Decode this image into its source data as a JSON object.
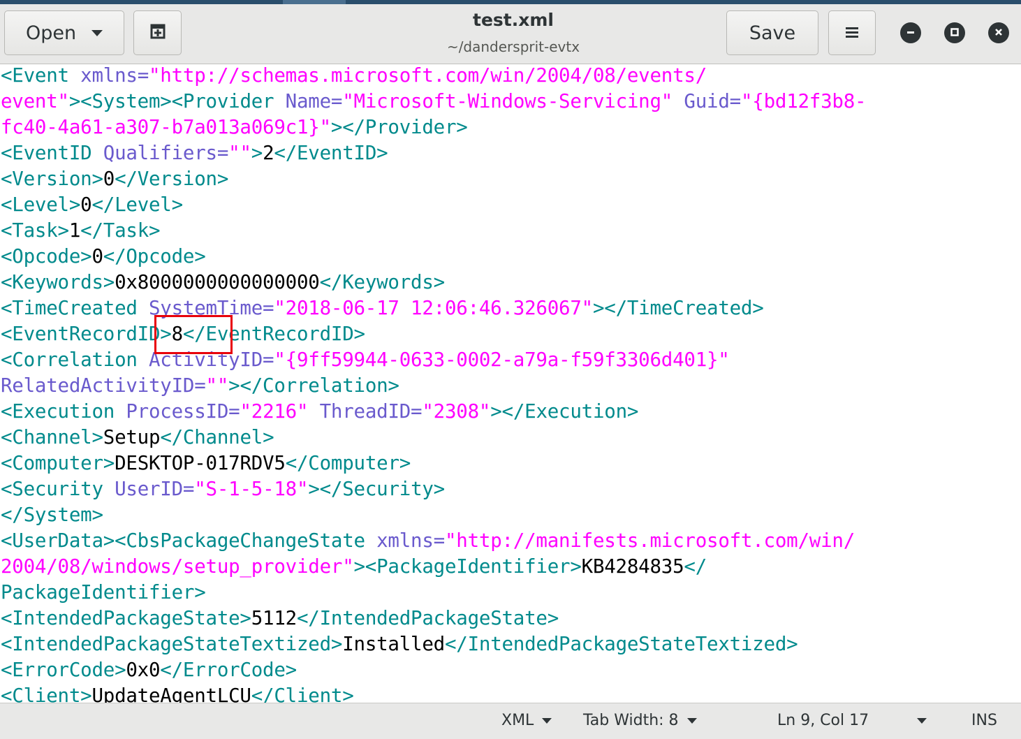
{
  "window": {
    "title": "test.xml",
    "subtitle": "~/dandersprit‑evtx"
  },
  "toolbar": {
    "open_label": "Open",
    "save_label": "Save"
  },
  "editor": {
    "lines": [
      [
        [
          "t",
          "<Event "
        ],
        [
          "a",
          "xmlns="
        ],
        [
          "v",
          "\"http://schemas.microsoft.com/win/2004/08/events/"
        ]
      ],
      [
        [
          "v",
          "event\""
        ],
        [
          "t",
          "><System><Provider "
        ],
        [
          "a",
          "Name="
        ],
        [
          "v",
          "\"Microsoft-Windows-Servicing\" "
        ],
        [
          "a",
          "Guid="
        ],
        [
          "v",
          "\"{bd12f3b8-"
        ]
      ],
      [
        [
          "v",
          "fc40-4a61-a307-b7a013a069c1}\""
        ],
        [
          "t",
          "></Provider>"
        ]
      ],
      [
        [
          "t",
          "<EventID "
        ],
        [
          "a",
          "Qualifiers="
        ],
        [
          "v",
          "\"\""
        ],
        [
          "t",
          ">"
        ],
        [
          "x",
          "2"
        ],
        [
          "t",
          "</EventID>"
        ]
      ],
      [
        [
          "t",
          "<Version>"
        ],
        [
          "x",
          "0"
        ],
        [
          "t",
          "</Version>"
        ]
      ],
      [
        [
          "t",
          "<Level>"
        ],
        [
          "x",
          "0"
        ],
        [
          "t",
          "</Level>"
        ]
      ],
      [
        [
          "t",
          "<Task>"
        ],
        [
          "x",
          "1"
        ],
        [
          "t",
          "</Task>"
        ]
      ],
      [
        [
          "t",
          "<Opcode>"
        ],
        [
          "x",
          "0"
        ],
        [
          "t",
          "</Opcode>"
        ]
      ],
      [
        [
          "t",
          "<Keywords>"
        ],
        [
          "x",
          "0x8000000000000000"
        ],
        [
          "t",
          "</Keywords>"
        ]
      ],
      [
        [
          "t",
          "<TimeCreated "
        ],
        [
          "a",
          "SystemTime="
        ],
        [
          "v",
          "\"2018-06-17 12:06:46.326067\""
        ],
        [
          "t",
          "></TimeCreated>"
        ]
      ],
      [
        [
          "t",
          "<EventRecordID>"
        ],
        [
          "x",
          "8"
        ],
        [
          "t",
          "</EventRecordID>"
        ]
      ],
      [
        [
          "t",
          "<Correlation "
        ],
        [
          "a",
          "ActivityID="
        ],
        [
          "v",
          "\"{9ff59944-0633-0002-a79a-f59f3306d401}\""
        ]
      ],
      [
        [
          "a",
          "RelatedActivityID="
        ],
        [
          "v",
          "\"\""
        ],
        [
          "t",
          "></Correlation>"
        ]
      ],
      [
        [
          "t",
          "<Execution "
        ],
        [
          "a",
          "ProcessID="
        ],
        [
          "v",
          "\"2216\" "
        ],
        [
          "a",
          "ThreadID="
        ],
        [
          "v",
          "\"2308\""
        ],
        [
          "t",
          "></Execution>"
        ]
      ],
      [
        [
          "t",
          "<Channel>"
        ],
        [
          "x",
          "Setup"
        ],
        [
          "t",
          "</Channel>"
        ]
      ],
      [
        [
          "t",
          "<Computer>"
        ],
        [
          "x",
          "DESKTOP-017RDV5"
        ],
        [
          "t",
          "</Computer>"
        ]
      ],
      [
        [
          "t",
          "<Security "
        ],
        [
          "a",
          "UserID="
        ],
        [
          "v",
          "\"S-1-5-18\""
        ],
        [
          "t",
          "></Security>"
        ]
      ],
      [
        [
          "t",
          "</System>"
        ]
      ],
      [
        [
          "t",
          "<UserData><CbsPackageChangeState "
        ],
        [
          "a",
          "xmlns="
        ],
        [
          "v",
          "\"http://manifests.microsoft.com/win/"
        ]
      ],
      [
        [
          "v",
          "2004/08/windows/setup_provider\""
        ],
        [
          "t",
          "><PackageIdentifier>"
        ],
        [
          "x",
          "KB4284835"
        ],
        [
          "t",
          "</"
        ]
      ],
      [
        [
          "t",
          "PackageIdentifier>"
        ]
      ],
      [
        [
          "t",
          "<IntendedPackageState>"
        ],
        [
          "x",
          "5112"
        ],
        [
          "t",
          "</IntendedPackageState>"
        ]
      ],
      [
        [
          "t",
          "<IntendedPackageStateTextized>"
        ],
        [
          "x",
          "Installed"
        ],
        [
          "t",
          "</IntendedPackageStateTextized>"
        ]
      ],
      [
        [
          "t",
          "<ErrorCode>"
        ],
        [
          "x",
          "0x0"
        ],
        [
          "t",
          "</ErrorCode>"
        ]
      ],
      [
        [
          "t",
          "<Client>"
        ],
        [
          "x",
          "UpdateAgentLCU"
        ],
        [
          "t",
          "</Client>"
        ]
      ]
    ]
  },
  "statusbar": {
    "language": "XML",
    "tab_width": "Tab Width: 8",
    "position": "Ln 9, Col 17",
    "mode": "INS"
  },
  "colors": {
    "tag": "#008a8c",
    "attribute": "#6a5acd",
    "value": "#ff00ff",
    "text": "#000000",
    "highlight_box": "#e8000b"
  }
}
